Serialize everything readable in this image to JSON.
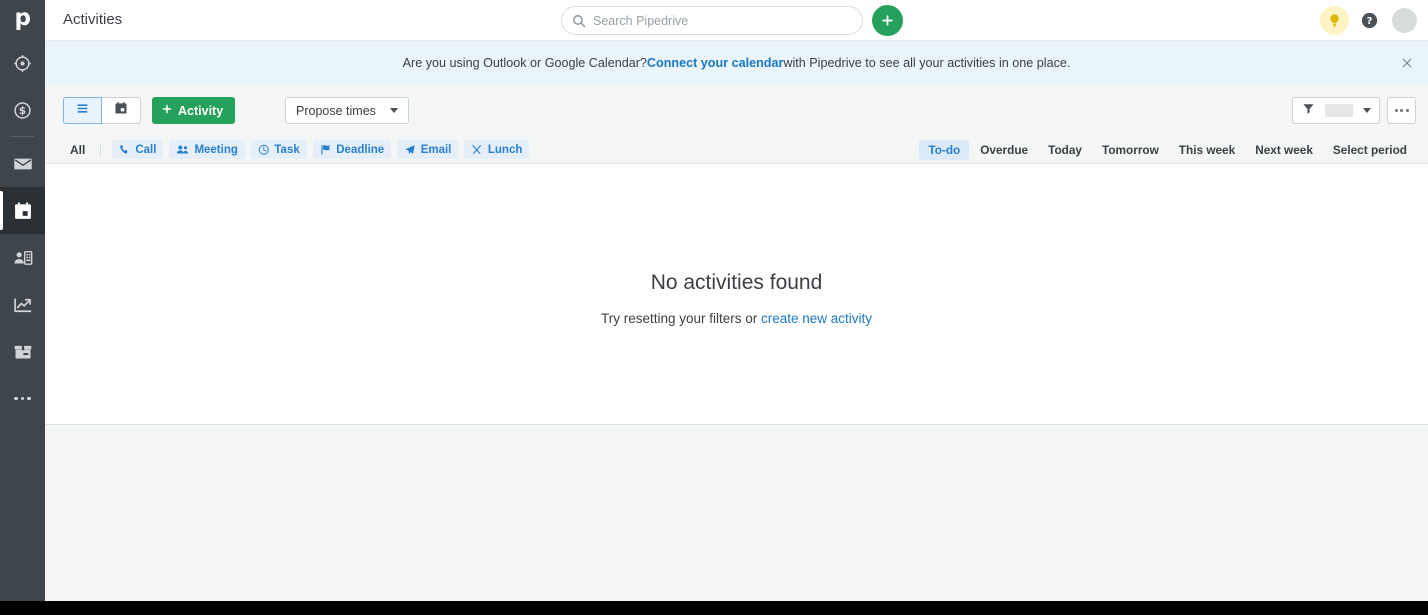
{
  "app": {
    "logo": "p",
    "accent_green": "#26a15b",
    "accent_blue": "#2a7fce",
    "rail_bg": "#3e454b"
  },
  "sidebar": {
    "items": [
      {
        "name": "leads",
        "icon": "target-icon",
        "label": "Leads"
      },
      {
        "name": "deals",
        "icon": "dollar-circle-icon",
        "label": "Deals"
      },
      {
        "name": "mail",
        "icon": "envelope-icon",
        "label": "Mail"
      },
      {
        "name": "activities",
        "icon": "calendar-icon",
        "label": "Activities",
        "active": true
      },
      {
        "name": "contacts",
        "icon": "contacts-card-icon",
        "label": "Contacts"
      },
      {
        "name": "insights",
        "icon": "chart-arrow-icon",
        "label": "Insights"
      },
      {
        "name": "products",
        "icon": "products-box-icon",
        "label": "Products"
      },
      {
        "name": "more",
        "icon": "ellipsis-icon",
        "label": "More"
      }
    ]
  },
  "header": {
    "title": "Activities",
    "search_placeholder": "Search Pipedrive",
    "search_value": "",
    "add_label": "+",
    "bulb_icon": "lightbulb-icon",
    "help_icon": "question-circle-icon",
    "avatar_icon": "avatar"
  },
  "banner": {
    "text_before": "Are you using Outlook or Google Calendar? ",
    "link": "Connect your calendar",
    "text_after": " with Pipedrive to see all your activities in one place.",
    "close_icon": "close-icon"
  },
  "toolbar": {
    "view_list_icon": "list-view-icon",
    "view_calendar_icon": "calendar-view-icon",
    "active_view": "list",
    "activity_label": "Activity",
    "propose_label": "Propose times",
    "filter_icon": "funnel-icon",
    "more_icon": "ellipsis-icon"
  },
  "filters": {
    "all_label": "All",
    "types": [
      {
        "label": "Call",
        "icon": "phone-icon"
      },
      {
        "label": "Meeting",
        "icon": "people-icon"
      },
      {
        "label": "Task",
        "icon": "clock-icon"
      },
      {
        "label": "Deadline",
        "icon": "flag-icon"
      },
      {
        "label": "Email",
        "icon": "paper-plane-icon"
      },
      {
        "label": "Lunch",
        "icon": "cutlery-icon"
      }
    ],
    "periods": [
      {
        "label": "To-do",
        "active": true
      },
      {
        "label": "Overdue",
        "active": false
      },
      {
        "label": "Today",
        "active": false
      },
      {
        "label": "Tomorrow",
        "active": false
      },
      {
        "label": "This week",
        "active": false
      },
      {
        "label": "Next week",
        "active": false
      },
      {
        "label": "Select period",
        "active": false
      }
    ]
  },
  "empty_state": {
    "title": "No activities found",
    "sub_before": "Try resetting your filters or ",
    "sub_link": "create new activity"
  }
}
